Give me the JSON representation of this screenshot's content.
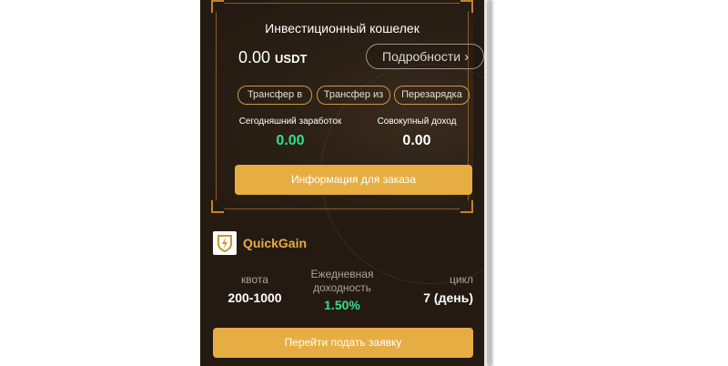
{
  "wallet": {
    "title": "Инвестиционный кошелек",
    "balance": "0.00",
    "currency": "USDT",
    "details_label": "Подробности",
    "details_icon": "chevron-right-icon",
    "actions": [
      {
        "label": "Трансфер в"
      },
      {
        "label": "Трансфер из"
      },
      {
        "label": "Перезарядка"
      }
    ],
    "today_earnings_label": "Сегодняшний заработок",
    "today_earnings_value": "0.00",
    "total_income_label": "Совокупный доход",
    "total_income_value": "0.00",
    "order_info_label": "Информация для заказа"
  },
  "product": {
    "logo_icon": "shield-bolt-logo-icon",
    "name": "QuickGain",
    "quota_label": "квота",
    "quota_value": "200-1000",
    "daily_yield_label_line1": "Ежедневная",
    "daily_yield_label_line2": "доходность",
    "daily_yield_value": "1.50%",
    "cycle_label": "цикл",
    "cycle_value": "7 (день)",
    "apply_label": "Перейти подать заявку"
  },
  "colors": {
    "accent": "#e6ad43",
    "positive": "#2fe08a",
    "background": "#241a12"
  }
}
